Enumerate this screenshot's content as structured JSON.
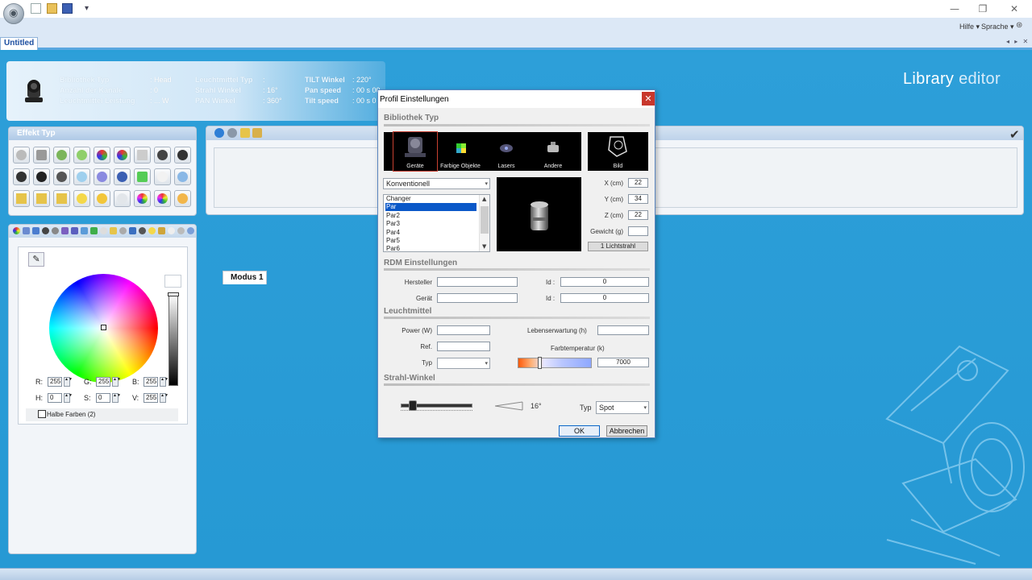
{
  "titlebar": {
    "window_controls": {
      "min": "—",
      "max": "❐",
      "close": "✕"
    },
    "quick_access": {
      "more": "▾"
    }
  },
  "menubar": {
    "hilfe": "Hilfe ▾",
    "sprache": "Sprache ▾"
  },
  "doc_tab": {
    "label": "Untitled",
    "nav": "◂ ▸ ✕"
  },
  "header": {
    "lib_title_a": "Library",
    "lib_title_b": " editor"
  },
  "info": {
    "bibliothek_typ_label": "Bibliothek Typ",
    "bibliothek_typ_value": ": Head",
    "anzahl_kanale_label": "Anzahl der Kanale",
    "anzahl_kanale_value": ": 0",
    "leuchtmittel_leistung_label": "Leuchtmittel Leistung",
    "leuchtmittel_leistung_value": ": ... W",
    "leuchtmittel_typ_label": "Leuchtmittel Typ",
    "leuchtmittel_typ_value": ":",
    "strahl_winkel_label": "Strahl Winkel",
    "strahl_winkel_value": ": 16°",
    "pan_winkel_label": "PAN Winkel",
    "pan_winkel_value": ": 360°",
    "tilt_winkel_label": "TILT Winkel",
    "tilt_winkel_value": ": 220°",
    "pan_speed_label": "Pan speed",
    "pan_speed_value": ": 00 s 00",
    "tilt_speed_label": "Tilt speed",
    "tilt_speed_value": ": 00 s 0"
  },
  "effekt_panel": {
    "title": "Effekt Typ"
  },
  "color_panel": {
    "r_label": "R:",
    "r_value": "255",
    "g_label": "G:",
    "g_value": "255",
    "b_label": "B:",
    "b_value": "255",
    "h_label": "H:",
    "h_value": "0",
    "s_label": "S:",
    "s_value": "0",
    "v_label": "V:",
    "v_value": "255",
    "halbe_farben": "Halbe Farben (2)"
  },
  "modus_panel": {
    "tab_label": "Modus 1"
  },
  "dialog": {
    "title": "Profil Einstellungen",
    "close": "✕",
    "section_bibliothek": "Bibliothek Typ",
    "lib_types": [
      "Geräte",
      "Farbige Objekte",
      "Lasers",
      "Andere"
    ],
    "bild_label": "Bild",
    "type_combo": "Konventionell",
    "list_items": [
      "Changer",
      "Par",
      "Par2",
      "Par3",
      "Par4",
      "Par5",
      "Par6"
    ],
    "selected_item": "Par",
    "x_label": "X (cm)",
    "x_value": "22",
    "y_label": "Y (cm)",
    "y_value": "34",
    "z_label": "Z (cm)",
    "z_value": "22",
    "gewicht_label": "Gewicht (g)",
    "gewicht_value": "",
    "lichtstrahl_btn": "1 Lichtstrahl",
    "section_rdm": "RDM Einstellungen",
    "hersteller_label": "Hersteller",
    "hersteller_value": "",
    "geraet_label": "Gerät",
    "geraet_value": "",
    "id_label": "Id :",
    "id1_value": "0",
    "id2_value": "0",
    "section_leuchtmittel": "Leuchtmittel",
    "power_label": "Power (W)",
    "power_value": "",
    "ref_label": "Ref.",
    "ref_value": "",
    "typ_label": "Typ",
    "typ_value": "",
    "lebens_label": "Lebenserwartung (h)",
    "lebens_value": "",
    "farbtemp_label": "Farbtemperatur (k)",
    "farbtemp_value": "7000",
    "section_strahl": "Strahl-Winkel",
    "beam_angle": "16°",
    "typ2_label": "Typ",
    "typ2_value": "Spot",
    "ok": "OK",
    "cancel": "Abbrechen"
  }
}
